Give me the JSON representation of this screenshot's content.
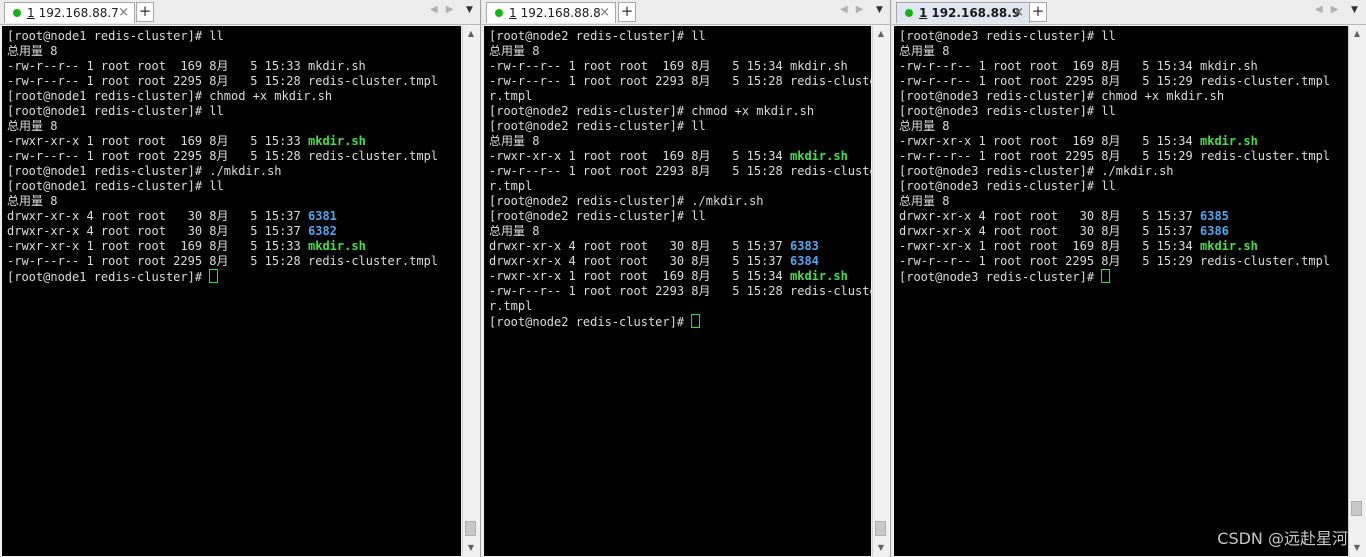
{
  "colors": {
    "terminal_bg": "#000000",
    "text": "#dcdcdc",
    "executable": "#44e144",
    "directory": "#4fa8f0",
    "connected_dot": "#17b217",
    "cursor": "#2ee62e"
  },
  "panes": [
    {
      "tab": {
        "number": "1",
        "host": "192.168.88.7",
        "close": "×",
        "active": false
      },
      "add_tab": "+",
      "menu_arrow": "▼",
      "lines": [
        [
          {
            "t": "[root@node1 redis-cluster]# ll"
          }
        ],
        [
          {
            "t": "总用量 8"
          }
        ],
        [
          {
            "t": "-rw-r--r-- 1 root root  169 8月   5 15:33 mkdir.sh"
          }
        ],
        [
          {
            "t": "-rw-r--r-- 1 root root 2295 8月   5 15:28 redis-cluster.tmpl"
          }
        ],
        [
          {
            "t": "[root@node1 redis-cluster]# chmod +x mkdir.sh"
          }
        ],
        [
          {
            "t": "[root@node1 redis-cluster]# ll"
          }
        ],
        [
          {
            "t": "总用量 8"
          }
        ],
        [
          {
            "t": "-rwxr-xr-x 1 root root  169 8月   5 15:33 "
          },
          {
            "t": "mkdir.sh",
            "c": "exe"
          }
        ],
        [
          {
            "t": "-rw-r--r-- 1 root root 2295 8月   5 15:28 redis-cluster.tmpl"
          }
        ],
        [
          {
            "t": "[root@node1 redis-cluster]# ./mkdir.sh"
          }
        ],
        [
          {
            "t": "[root@node1 redis-cluster]# ll"
          }
        ],
        [
          {
            "t": "总用量 8"
          }
        ],
        [
          {
            "t": "drwxr-xr-x 4 root root   30 8月   5 15:37 "
          },
          {
            "t": "6381",
            "c": "dir"
          }
        ],
        [
          {
            "t": "drwxr-xr-x 4 root root   30 8月   5 15:37 "
          },
          {
            "t": "6382",
            "c": "dir"
          }
        ],
        [
          {
            "t": "-rwxr-xr-x 1 root root  169 8月   5 15:33 "
          },
          {
            "t": "mkdir.sh",
            "c": "exe"
          }
        ],
        [
          {
            "t": "-rw-r--r-- 1 root root 2295 8月   5 15:28 redis-cluster.tmpl"
          }
        ],
        [
          {
            "t": "[root@node1 redis-cluster]# "
          },
          {
            "t": "",
            "c": "cursor"
          }
        ]
      ]
    },
    {
      "tab": {
        "number": "1",
        "host": "192.168.88.8",
        "close": "×",
        "active": false
      },
      "add_tab": "+",
      "menu_arrow": "▼",
      "lines": [
        [
          {
            "t": "[root@node2 redis-cluster]# ll"
          }
        ],
        [
          {
            "t": "总用量 8"
          }
        ],
        [
          {
            "t": "-rw-r--r-- 1 root root  169 8月   5 15:34 mkdir.sh"
          }
        ],
        [
          {
            "t": "-rw-r--r-- 1 root root 2293 8月   5 15:28 redis-cluste"
          }
        ],
        [
          {
            "t": "r.tmpl"
          }
        ],
        [
          {
            "t": "[root@node2 redis-cluster]# chmod +x mkdir.sh"
          }
        ],
        [
          {
            "t": "[root@node2 redis-cluster]# ll"
          }
        ],
        [
          {
            "t": "总用量 8"
          }
        ],
        [
          {
            "t": "-rwxr-xr-x 1 root root  169 8月   5 15:34 "
          },
          {
            "t": "mkdir.sh",
            "c": "exe"
          }
        ],
        [
          {
            "t": "-rw-r--r-- 1 root root 2293 8月   5 15:28 redis-cluste"
          }
        ],
        [
          {
            "t": "r.tmpl"
          }
        ],
        [
          {
            "t": "[root@node2 redis-cluster]# ./mkdir.sh"
          }
        ],
        [
          {
            "t": "[root@node2 redis-cluster]# ll"
          }
        ],
        [
          {
            "t": "总用量 8"
          }
        ],
        [
          {
            "t": "drwxr-xr-x 4 root root   30 8月   5 15:37 "
          },
          {
            "t": "6383",
            "c": "dir"
          }
        ],
        [
          {
            "t": "drwxr-xr-x 4 root root   30 8月   5 15:37 "
          },
          {
            "t": "6384",
            "c": "dir"
          }
        ],
        [
          {
            "t": "-rwxr-xr-x 1 root root  169 8月   5 15:34 "
          },
          {
            "t": "mkdir.sh",
            "c": "exe"
          }
        ],
        [
          {
            "t": "-rw-r--r-- 1 root root 2293 8月   5 15:28 redis-cluste"
          }
        ],
        [
          {
            "t": "r.tmpl"
          }
        ],
        [
          {
            "t": "[root@node2 redis-cluster]# "
          },
          {
            "t": "",
            "c": "cursor"
          }
        ]
      ]
    },
    {
      "tab": {
        "number": "1",
        "host": "192.168.88.9",
        "close": "×",
        "active": true
      },
      "add_tab": "+",
      "menu_arrow": "▼",
      "lines": [
        [
          {
            "t": "[root@node3 redis-cluster]# ll"
          }
        ],
        [
          {
            "t": "总用量 8"
          }
        ],
        [
          {
            "t": "-rw-r--r-- 1 root root  169 8月   5 15:34 mkdir.sh"
          }
        ],
        [
          {
            "t": "-rw-r--r-- 1 root root 2295 8月   5 15:29 redis-cluster.tmpl"
          }
        ],
        [
          {
            "t": "[root@node3 redis-cluster]# chmod +x mkdir.sh"
          }
        ],
        [
          {
            "t": "[root@node3 redis-cluster]# ll"
          }
        ],
        [
          {
            "t": "总用量 8"
          }
        ],
        [
          {
            "t": "-rwxr-xr-x 1 root root  169 8月   5 15:34 "
          },
          {
            "t": "mkdir.sh",
            "c": "exe"
          }
        ],
        [
          {
            "t": "-rw-r--r-- 1 root root 2295 8月   5 15:29 redis-cluster.tmpl"
          }
        ],
        [
          {
            "t": "[root@node3 redis-cluster]# ./mkdir.sh"
          }
        ],
        [
          {
            "t": "[root@node3 redis-cluster]# ll"
          }
        ],
        [
          {
            "t": "总用量 8"
          }
        ],
        [
          {
            "t": "drwxr-xr-x 4 root root   30 8月   5 15:37 "
          },
          {
            "t": "6385",
            "c": "dir"
          }
        ],
        [
          {
            "t": "drwxr-xr-x 4 root root   30 8月   5 15:37 "
          },
          {
            "t": "6386",
            "c": "dir"
          }
        ],
        [
          {
            "t": "-rwxr-xr-x 1 root root  169 8月   5 15:34 "
          },
          {
            "t": "mkdir.sh",
            "c": "exe"
          }
        ],
        [
          {
            "t": "-rw-r--r-- 1 root root 2295 8月   5 15:29 redis-cluster.tmpl"
          }
        ],
        [
          {
            "t": "[root@node3 redis-cluster]# "
          },
          {
            "t": "",
            "c": "cursor"
          }
        ]
      ]
    }
  ],
  "watermark": "CSDN @远赴星河"
}
